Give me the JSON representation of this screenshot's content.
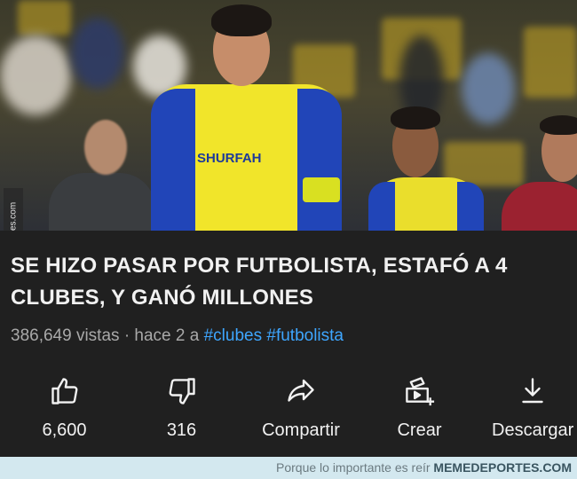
{
  "thumbnail": {
    "side_watermark": "Memedeportes.com",
    "jersey_text": "SHURFAH"
  },
  "video": {
    "title": "SE HIZO PASAR POR FUTBOLISTA, ESTAFÓ A 4 CLUBES, Y GANÓ MILLONES",
    "views": "386,649 vistas",
    "age": "· hace 2 a",
    "tags": [
      "#clubes",
      "#futbolista"
    ]
  },
  "actions": [
    {
      "label": "6,600",
      "icon": "thumbs-up-icon"
    },
    {
      "label": "316",
      "icon": "thumbs-down-icon"
    },
    {
      "label": "Compartir",
      "icon": "share-icon"
    },
    {
      "label": "Crear",
      "icon": "create-icon"
    },
    {
      "label": "Descargar",
      "icon": "download-icon"
    }
  ],
  "footer": {
    "caption": "Porque lo importante es reír",
    "site": "MEMEDEPORTES.COM"
  }
}
